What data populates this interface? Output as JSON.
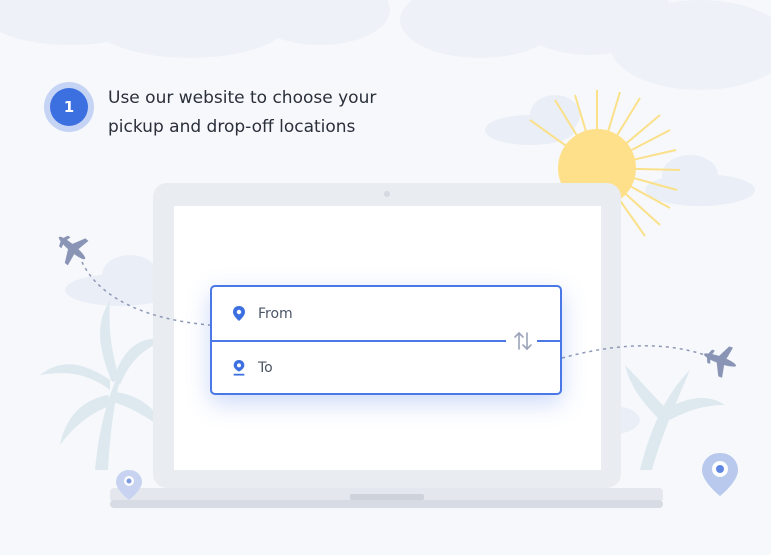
{
  "step": {
    "number": "1",
    "line1": "Use our website to choose your",
    "line2": "pickup and drop-off locations"
  },
  "form": {
    "from_label": "From",
    "to_label": "To",
    "swap_icon": "swap-vertical-icon",
    "pin_icon": "location-pin-icon"
  },
  "colors": {
    "accent": "#3c6fe0",
    "border": "#4a78e6",
    "sun": "#ffe08a",
    "plane": "#8a95b5"
  }
}
